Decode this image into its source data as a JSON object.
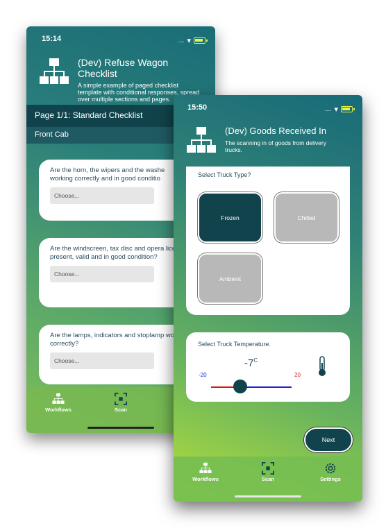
{
  "back_phone": {
    "status_time": "15:14",
    "status_signal": "....",
    "header_title": "(Dev) Refuse Wagon Checklist",
    "header_desc": "A simple example of paged checklist template with conditional responses, spread over multiple sections and pages.",
    "page_title": "Page 1/1: Standard Checklist",
    "section_title": "Front Cab",
    "questions": [
      {
        "text": "Are the horn, the wipers and the washe working correctly and in good conditio",
        "choose": "Choose..."
      },
      {
        "text": "Are the windscreen, tax disc and opera licence present, valid and in good condition?",
        "choose": "Choose..."
      },
      {
        "text": "Are the lamps, indicators and stoplamp working correctly?",
        "choose": "Choose..."
      }
    ],
    "tabs": {
      "workflows": "Workflows",
      "scan": "Scan"
    }
  },
  "front_phone": {
    "status_time": "15:50",
    "status_signal": "....",
    "header_title": "(Dev) Goods Received In",
    "header_desc": "The scanning in of goods from delivery trucks.",
    "truck_type": {
      "label": "Select Truck Type?",
      "options": [
        {
          "label": "Frozen",
          "selected": true
        },
        {
          "label": "Chilled",
          "selected": false
        },
        {
          "label": "Ambient",
          "selected": false
        }
      ]
    },
    "temperature": {
      "label": "Select Truck Temperature.",
      "value": "-7",
      "unit": "C",
      "min": "-20",
      "max": "20"
    },
    "next_label": "Next",
    "tabs": {
      "workflows": "Workflows",
      "scan": "Scan",
      "settings": "Settings"
    }
  },
  "colors": {
    "dark_teal": "#11434c",
    "selected_button": "#11434c",
    "unselected_button": "#b8b8b8",
    "min_temp": "#1a22d6",
    "max_temp": "#d61a1a"
  },
  "icons": [
    "workflow-icon",
    "scan-icon",
    "settings-icon",
    "list-icon",
    "thermometer-icon",
    "wifi-icon",
    "battery-icon"
  ]
}
